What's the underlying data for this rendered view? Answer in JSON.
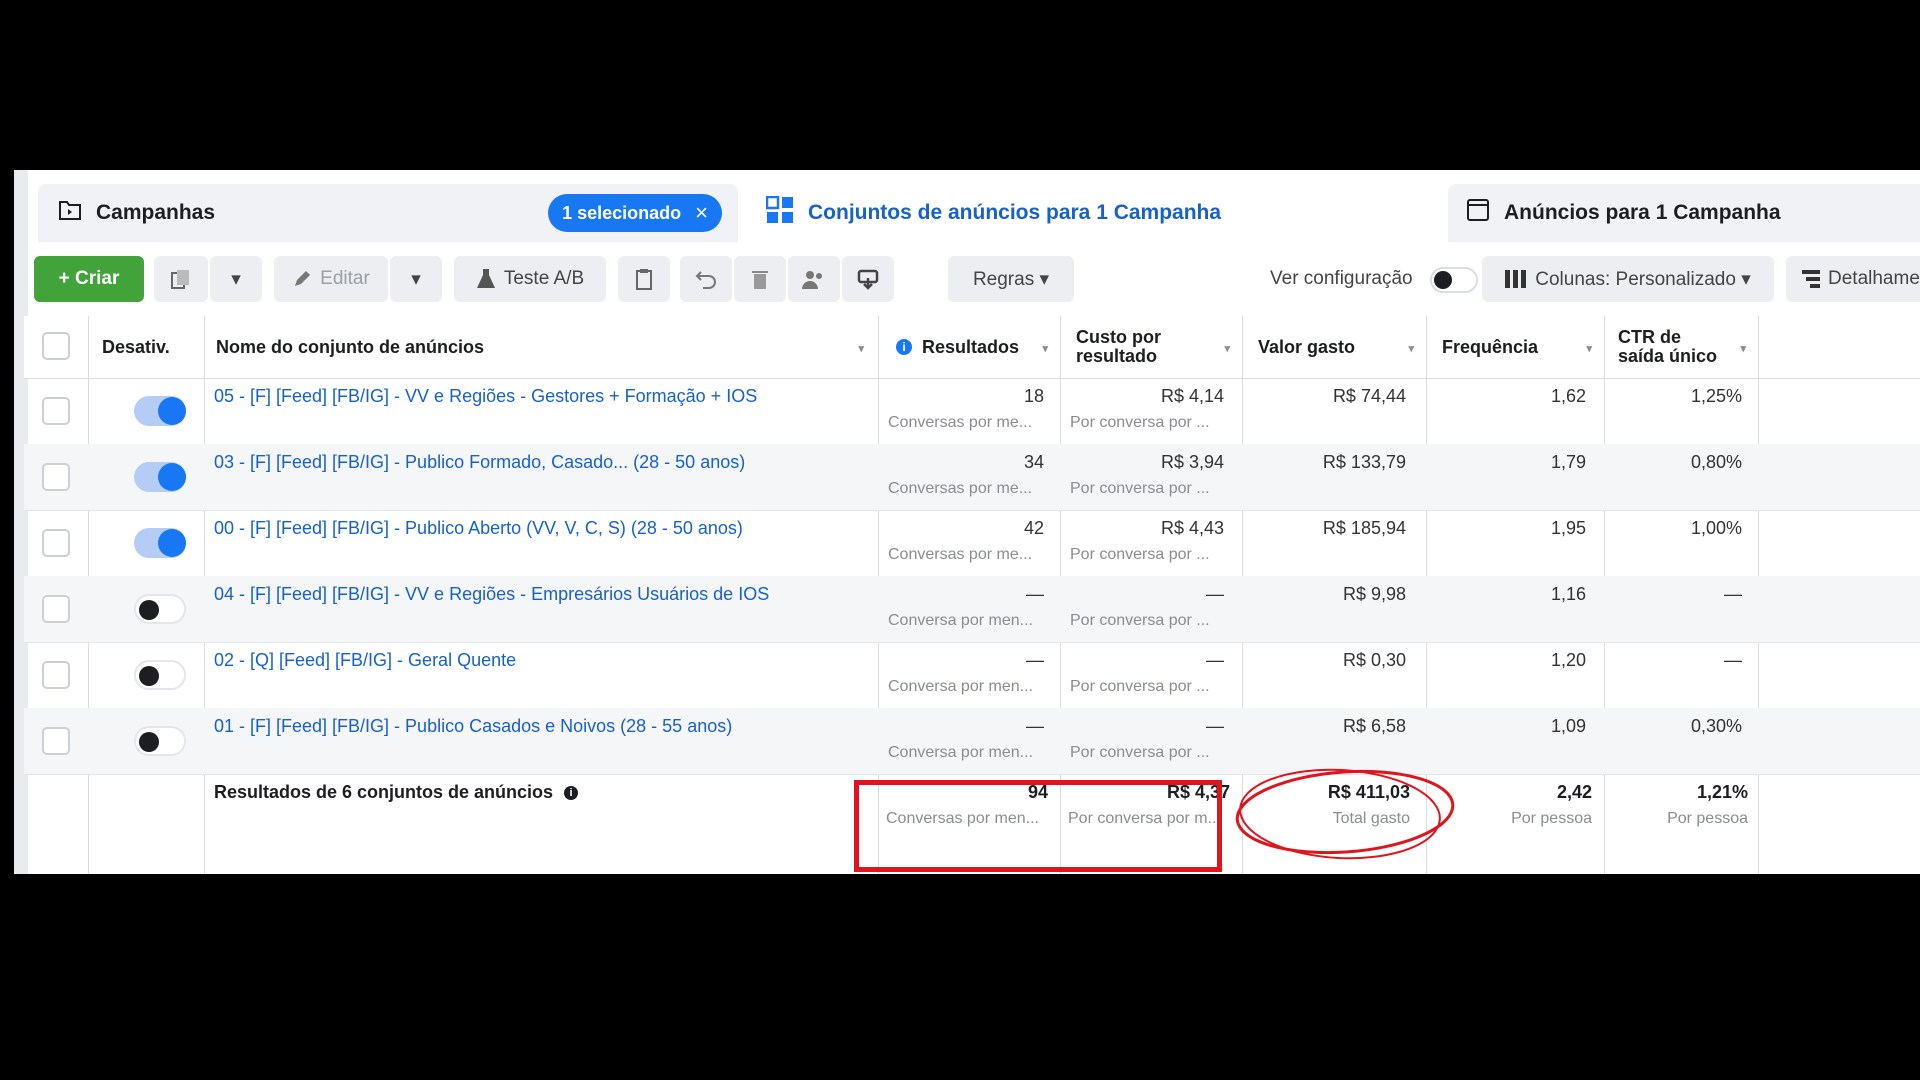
{
  "tabs": {
    "campaigns": {
      "label": "Campanhas",
      "badge": "1 selecionado",
      "badge_close": "×"
    },
    "adsets": {
      "label": "Conjuntos de anúncios para 1 Campanha"
    },
    "ads": {
      "label": "Anúncios para 1 Campanha"
    }
  },
  "toolbar": {
    "create": "+ Criar",
    "edit": "Editar",
    "ab_test": "Teste A/B",
    "rules": "Regras ▾",
    "view_config": "Ver configuração",
    "columns": "Colunas: Personalizado ▾",
    "breakdown": "Detalhamento"
  },
  "table": {
    "headers": {
      "off": "Desativ.",
      "name": "Nome do conjunto de anúncios",
      "results": "Resultados",
      "cost_line1": "Custo por",
      "cost_line2": "resultado",
      "spent": "Valor gasto",
      "frequency": "Frequência",
      "ctr_line1": "CTR de",
      "ctr_line2": "saída único"
    },
    "rows": [
      {
        "on": true,
        "name": "05 - [F] [Feed] [FB/IG] - VV e Regiões - Gestores + Formação + IOS",
        "results": "18",
        "results_sub": "Conversas por me...",
        "cost": "R$ 4,14",
        "cost_sub": "Por conversa por ...",
        "spent": "R$ 74,44",
        "frequency": "1,62",
        "ctr": "1,25%"
      },
      {
        "on": true,
        "name": "03 - [F] [Feed] [FB/IG] - Publico Formado, Casado... (28 - 50 anos)",
        "results": "34",
        "results_sub": "Conversas por me...",
        "cost": "R$ 3,94",
        "cost_sub": "Por conversa por ...",
        "spent": "R$ 133,79",
        "frequency": "1,79",
        "ctr": "0,80%"
      },
      {
        "on": true,
        "name": "00 - [F] [Feed] [FB/IG] - Publico Aberto (VV, V, C, S) (28 - 50 anos)",
        "results": "42",
        "results_sub": "Conversas por me...",
        "cost": "R$ 4,43",
        "cost_sub": "Por conversa por ...",
        "spent": "R$ 185,94",
        "frequency": "1,95",
        "ctr": "1,00%"
      },
      {
        "on": false,
        "name": "04 - [F] [Feed] [FB/IG] - VV e Regiões - Empresários Usuários de IOS",
        "results": "—",
        "results_sub": "Conversa por men...",
        "cost": "—",
        "cost_sub": "Por conversa por ...",
        "spent": "R$ 9,98",
        "frequency": "1,16",
        "ctr": "—"
      },
      {
        "on": false,
        "name": "02 - [Q] [Feed] [FB/IG] - Geral Quente",
        "results": "—",
        "results_sub": "Conversa por men...",
        "cost": "—",
        "cost_sub": "Por conversa por ...",
        "spent": "R$ 0,30",
        "frequency": "1,20",
        "ctr": "—"
      },
      {
        "on": false,
        "name": "01 - [F] [Feed] [FB/IG] - Publico Casados e Noivos (28 - 55 anos)",
        "results": "—",
        "results_sub": "Conversa por men...",
        "cost": "—",
        "cost_sub": "Por conversa por ...",
        "spent": "R$ 6,58",
        "frequency": "1,09",
        "ctr": "0,30%"
      }
    ],
    "totals": {
      "label": "Resultados de 6 conjuntos de anúncios",
      "results": "94",
      "results_sub": "Conversas por men...",
      "cost": "R$ 4,37",
      "cost_sub": "Por conversa por m...",
      "spent": "R$ 411,03",
      "spent_sub": "Total gasto",
      "frequency": "2,42",
      "frequency_sub": "Por pessoa",
      "ctr": "1,21%",
      "ctr_sub": "Por pessoa"
    }
  },
  "colors": {
    "accent": "#1877f2",
    "create": "#42a33a",
    "highlight": "#e0141e"
  }
}
